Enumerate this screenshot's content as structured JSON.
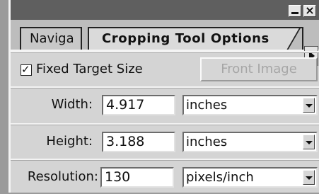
{
  "window": {
    "minimize_icon": "minimize-icon",
    "close_icon": "close-icon",
    "close_glyph": "×"
  },
  "tabs": [
    {
      "label": "Naviga"
    },
    {
      "label": "Cropping Tool Options"
    }
  ],
  "tab_scroll_icon": "chevron-right-icon",
  "options": {
    "fixed_target": {
      "label": "Fixed Target Size",
      "checked": true,
      "mark": "✓"
    },
    "front_image_label": "Front Image"
  },
  "fields": {
    "width": {
      "label": "Width:",
      "value": "4.917",
      "unit": "inches"
    },
    "height": {
      "label": "Height:",
      "value": "3.188",
      "unit": "inches"
    },
    "resolution": {
      "label": "Resolution:",
      "value": "130",
      "unit": "pixels/inch"
    }
  },
  "colors": {
    "titlebar": "#5f5f5f",
    "panel": "#d4d4d4",
    "disabled_text": "#a6a6a6"
  }
}
